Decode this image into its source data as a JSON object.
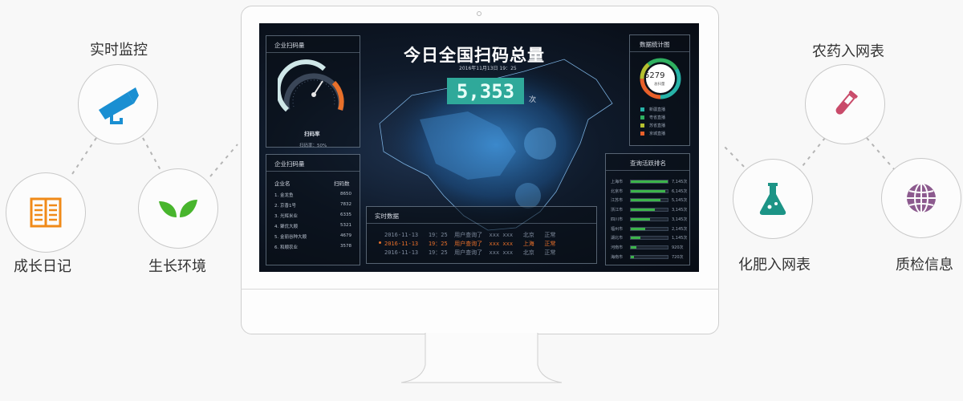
{
  "features": {
    "monitor": "实时监控",
    "diary": "成长日记",
    "environment": "生长环境",
    "pesticide": "农药入网表",
    "fertilizer": "化肥入网表",
    "quality": "质检信息"
  },
  "dashboard": {
    "title": "今日全国扫码总量",
    "datetime": "2016年11月13日  19：25",
    "total": "5,353",
    "unit": "次",
    "gauge": {
      "panel_title": "企业扫码量",
      "label": "扫码率",
      "rate_text": "扫码率：50%",
      "value": 0.5
    },
    "company": {
      "panel_title": "企业扫码量",
      "col_name": "企业名",
      "col_count": "扫码数",
      "rows": [
        {
          "name": "1. 金龙鱼",
          "count": "8650"
        },
        {
          "name": "2. 京香1号",
          "count": "7832"
        },
        {
          "name": "3. 光辉米业",
          "count": "6335"
        },
        {
          "name": "4. 聚优大顺",
          "count": "5321"
        },
        {
          "name": "5. 金丽谷种大顺",
          "count": "4679"
        },
        {
          "name": "6. 和顺农业",
          "count": "3578"
        }
      ]
    },
    "realtime": {
      "panel_title": "实时数据",
      "rows": [
        {
          "date": "2016-11-13",
          "time": "19：25",
          "text": "用户查询了",
          "product": "xxx xxx",
          "city": "北京",
          "status": "正常",
          "highlight": false
        },
        {
          "date": "2016-11-13",
          "time": "19：25",
          "text": "用户查询了",
          "product": "xxx xxx",
          "city": "上海",
          "status": "正常",
          "highlight": true
        },
        {
          "date": "2016-11-13",
          "time": "19：25",
          "text": "用户查询了",
          "product": "xxx xxx",
          "city": "北京",
          "status": "正常",
          "highlight": false
        }
      ]
    },
    "stats": {
      "panel_title": "数据统计图",
      "center_value": "5279",
      "center_label": "总扫量",
      "legend": [
        {
          "label": "新疆直播",
          "color": "#27b3a8"
        },
        {
          "label": "粤省直播",
          "color": "#2fb060"
        },
        {
          "label": "苏省直播",
          "color": "#b5c030"
        },
        {
          "label": "京城直播",
          "color": "#e8602a"
        }
      ]
    },
    "ranking": {
      "panel_title": "查询活跃排名",
      "rows": [
        {
          "city": "上海市",
          "value": "7,145次",
          "fill": 0.95
        },
        {
          "city": "北京市",
          "value": "6,145次",
          "fill": 0.9
        },
        {
          "city": "江苏市",
          "value": "5,145次",
          "fill": 0.78
        },
        {
          "city": "浙江市",
          "value": "3,145次",
          "fill": 0.62
        },
        {
          "city": "四川市",
          "value": "3,145次",
          "fill": 0.5
        },
        {
          "city": "福州市",
          "value": "2,145次",
          "fill": 0.38
        },
        {
          "city": "湖北市",
          "value": "1,145次",
          "fill": 0.26
        },
        {
          "city": "河南市",
          "value": "920次",
          "fill": 0.15
        },
        {
          "city": "海南市",
          "value": "720次",
          "fill": 0.08
        }
      ]
    }
  }
}
